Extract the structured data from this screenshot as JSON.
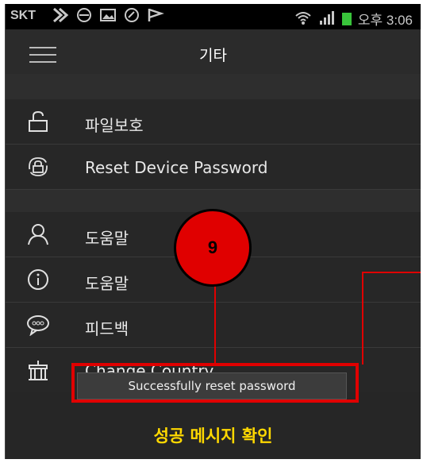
{
  "status_bar": {
    "carrier": "SKT",
    "time": "오후 3:06"
  },
  "app_bar": {
    "title": "기타"
  },
  "menu": [
    {
      "label": "파일보호",
      "icon": "lock-icon"
    },
    {
      "label": "Reset Device Password",
      "icon": "lock-reset-icon"
    },
    {
      "label": "도움말",
      "icon": "user-icon"
    },
    {
      "label": "도움말",
      "icon": "info-icon"
    },
    {
      "label": "피드백",
      "icon": "chat-bubble-icon"
    },
    {
      "label": "Change Country",
      "icon": "building-icon"
    }
  ],
  "toast": {
    "text": "Successfully reset password"
  },
  "annotation": {
    "step": "9",
    "caption": "성공 메시지 확인"
  },
  "colors": {
    "highlight": "#e00000",
    "caption": "#ffd800"
  }
}
